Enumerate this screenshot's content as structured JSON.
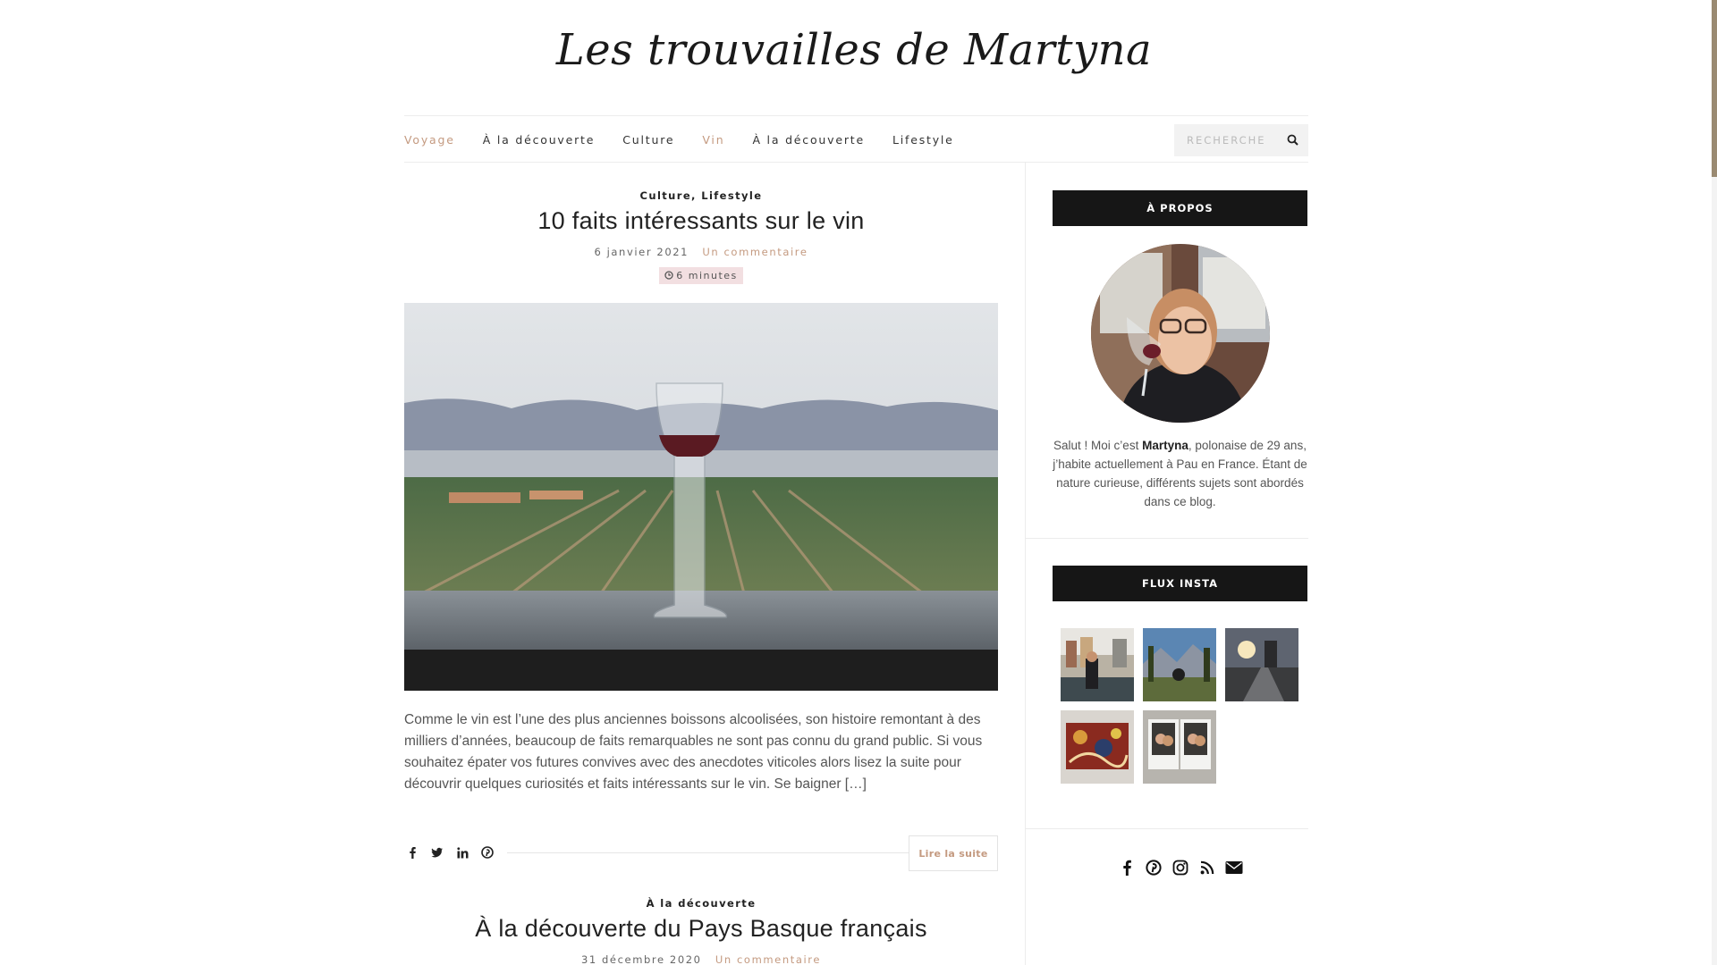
{
  "site": {
    "title": "Les trouvailles de Martyna"
  },
  "nav": {
    "items": [
      {
        "label": "Voyage",
        "active": true
      },
      {
        "label": "À la découverte",
        "active": false
      },
      {
        "label": "Culture",
        "active": false
      },
      {
        "label": "Vin",
        "active": true
      },
      {
        "label": "À la découverte",
        "active": false
      },
      {
        "label": "Lifestyle",
        "active": false
      }
    ],
    "search_placeholder": "RECHERCHE"
  },
  "posts": [
    {
      "categories": "Culture, Lifestyle",
      "title": "10 faits intéressants sur le vin",
      "date": "6 janvier 2021",
      "comments": "Un commentaire",
      "read_time": "6 minutes",
      "excerpt": "Comme le vin est l’une des plus anciennes boissons alcoolisées, son histoire remontant à des milliers d’années, beaucoup de faits remarquables ne sont pas connu du grand public. Si vous souhaitez épater vos futures convives avec des anecdotes viticoles alors lisez la suite pour découvrir quelques curiosités et faits intéressants sur le vin. Se baigner […]",
      "read_more": "Lire la suite"
    },
    {
      "categories": "À la découverte",
      "title": "À la découverte du Pays Basque français",
      "date": "31 décembre 2020",
      "comments": "Un commentaire"
    }
  ],
  "sidebar": {
    "about_title": "À PROPOS",
    "about_pre": "Salut ! Moi c’est ",
    "about_name": "Martyna",
    "about_post": ", polonaise de 29 ans, j’habite actuellement à Pau en France. Étant de nature curieuse, différents sujets sont abordés dans ce blog.",
    "insta_title": "FLUX INSTA"
  },
  "colors": {
    "accent": "#c49a80",
    "widget_bg": "#161616",
    "badge_bg": "#f2dfe1"
  },
  "icons": {
    "share": [
      "facebook-icon",
      "twitter-icon",
      "linkedin-icon",
      "pinterest-icon"
    ],
    "social": [
      "facebook-icon",
      "pinterest-icon",
      "instagram-icon",
      "rss-icon",
      "envelope-icon"
    ]
  }
}
